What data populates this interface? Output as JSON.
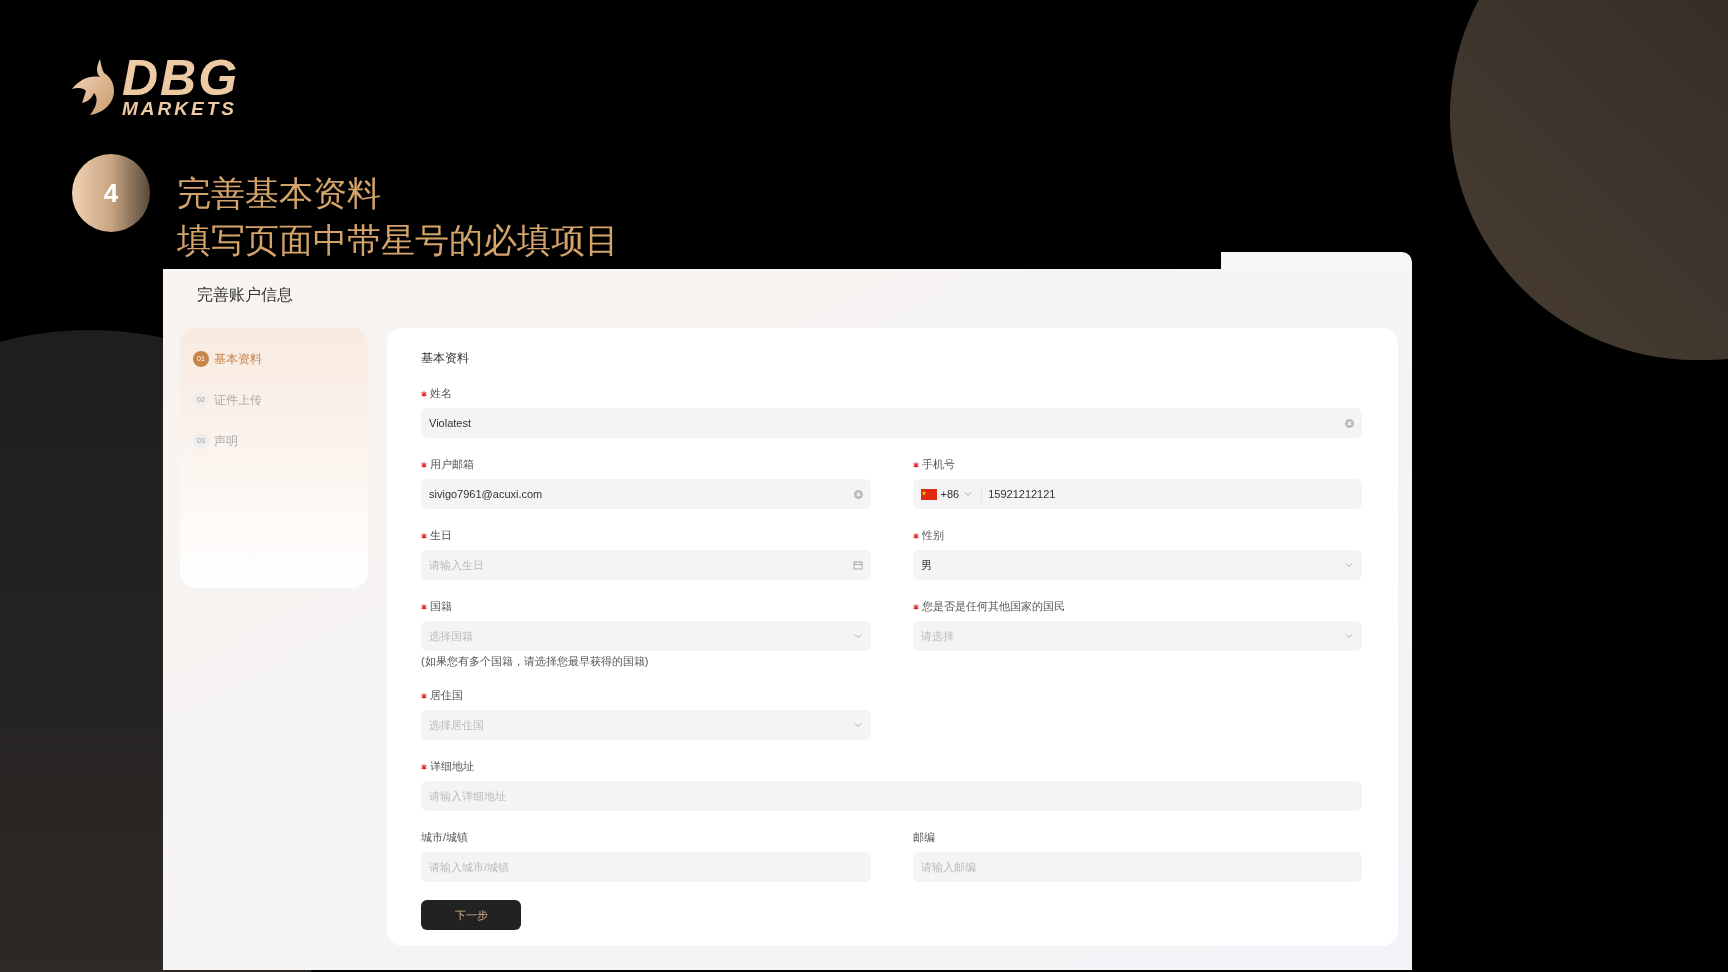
{
  "logo": {
    "wordmark": "DBG",
    "tagline": "MARKETS"
  },
  "step_badge": "4",
  "headline": [
    "完善基本资料",
    "填写页面中带星号的必填项目"
  ],
  "app": {
    "title": "完善账户信息",
    "steps": [
      {
        "number": "01",
        "label": "基本资料",
        "selected": true
      },
      {
        "number": "02",
        "label": "证件上传",
        "selected": false
      },
      {
        "number": "03",
        "label": "声明",
        "selected": false
      }
    ],
    "form": {
      "section_title": "基本资料",
      "fields": [
        {
          "label": "姓名",
          "required": true,
          "kind": "text",
          "value": "Violatest",
          "wide": true
        },
        {
          "label": "用户邮箱",
          "required": true,
          "kind": "text",
          "value": "sivigo7961@acuxi.com",
          "wide": false
        },
        {
          "label": "手机号",
          "required": true,
          "kind": "phone",
          "country_code": "+86",
          "value": "15921212121",
          "wide": false
        },
        {
          "label": "生日",
          "required": true,
          "kind": "date",
          "placeholder": "请输入生日",
          "wide": false
        },
        {
          "label": "性别",
          "required": true,
          "kind": "select",
          "value": "男",
          "wide": false
        },
        {
          "label": "国籍",
          "required": true,
          "kind": "select",
          "placeholder": "选择国籍",
          "hint": "(如果您有多个国籍，请选择您最早获得的国籍)",
          "wide": false
        },
        {
          "label": "您是否是任何其他国家的国民",
          "required": true,
          "kind": "select",
          "placeholder": "请选择",
          "wide": false
        },
        {
          "label": "居住国",
          "required": true,
          "kind": "select",
          "placeholder": "选择居住国",
          "wide": false
        },
        {
          "label": "详细地址",
          "required": true,
          "kind": "text",
          "placeholder": "请输入详细地址",
          "wide": true
        },
        {
          "label": "城市/城镇",
          "required": false,
          "kind": "text",
          "placeholder": "请输入城市/城镇",
          "wide": false
        },
        {
          "label": "邮编",
          "required": false,
          "kind": "text",
          "placeholder": "请输入邮编",
          "wide": false
        }
      ],
      "submit": "下一步"
    }
  }
}
